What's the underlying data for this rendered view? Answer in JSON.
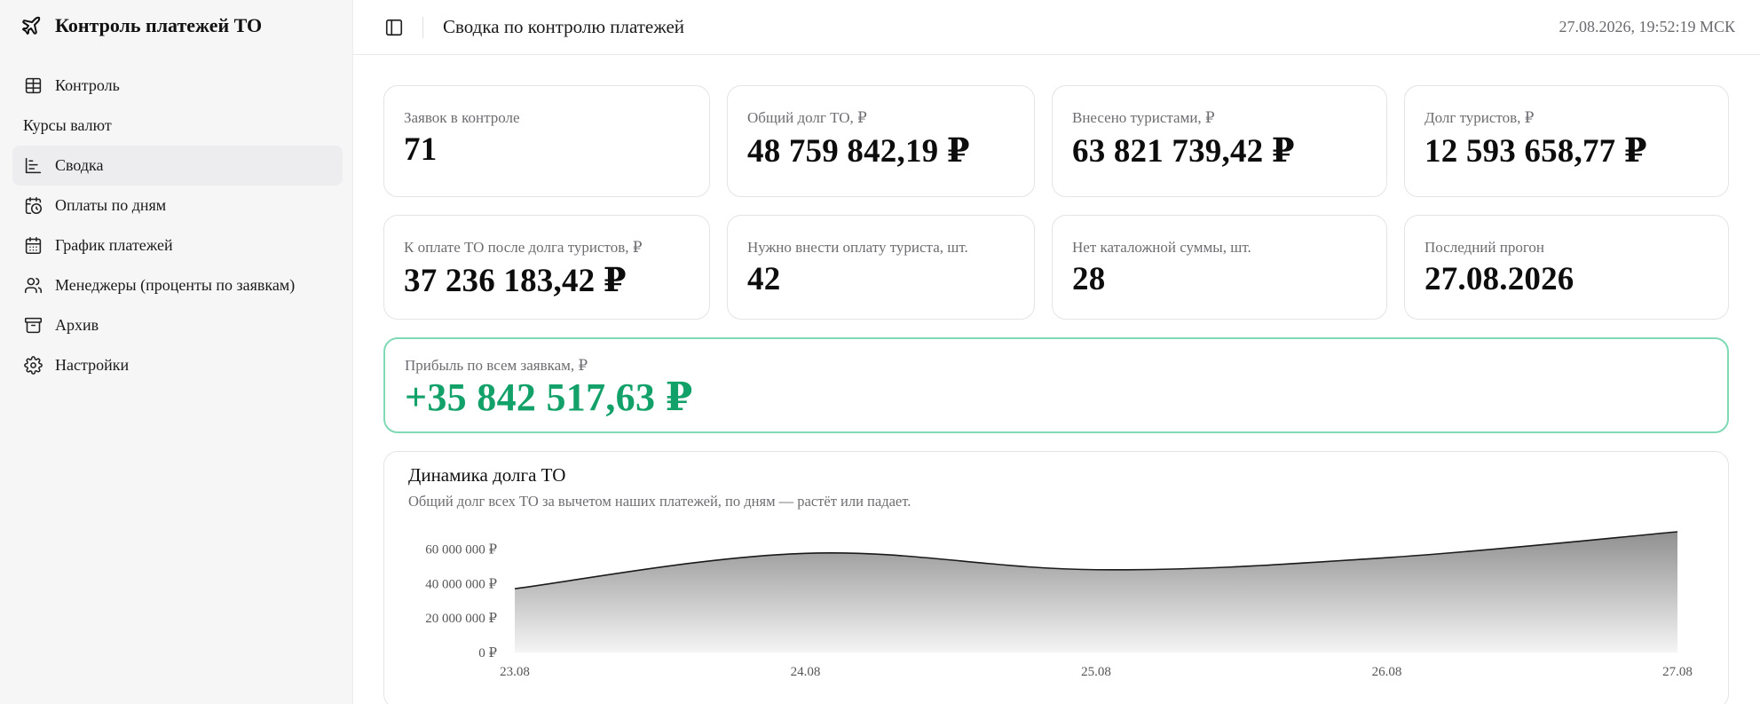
{
  "app": {
    "brand_title": "Контроль платежей ТО",
    "brand_icon": "plane-icon"
  },
  "sidebar": {
    "items": [
      {
        "label": "Контроль",
        "icon": "table-icon"
      },
      {
        "label": "Курсы валют",
        "icon": ""
      },
      {
        "label": "Сводка",
        "icon": "bar-chart-icon",
        "active": true
      },
      {
        "label": "Оплаты по дням",
        "icon": "calendar-clock-icon"
      },
      {
        "label": "График платежей",
        "icon": "calendar-icon"
      },
      {
        "label": "Менеджеры (проценты по заявкам)",
        "icon": "users-icon"
      },
      {
        "label": "Архив",
        "icon": "archive-icon"
      },
      {
        "label": "Настройки",
        "icon": "gear-icon"
      }
    ]
  },
  "header": {
    "title": "Сводка по контролю платежей",
    "timestamp": "27.08.2026, 19:52:19 МСК",
    "toggle_icon": "sidebar-toggle-icon"
  },
  "stats": [
    {
      "label": "Заявок в контроле",
      "value": "71"
    },
    {
      "label": "Общий долг ТО, ₽",
      "value": "48 759 842,19 ₽"
    },
    {
      "label": "Внесено туристами, ₽",
      "value": "63 821 739,42 ₽"
    },
    {
      "label": "Долг туристов, ₽",
      "value": "12 593 658,77 ₽"
    },
    {
      "label": "К оплате ТО после долга туристов, ₽",
      "value": "37 236 183,42 ₽"
    },
    {
      "label": "Нужно внести оплату туриста, шт.",
      "value": "42"
    },
    {
      "label": "Нет каталожной суммы, шт.",
      "value": "28"
    },
    {
      "label": "Последний прогон",
      "value": "27.08.2026"
    }
  ],
  "profit": {
    "label": "Прибыль по всем заявкам, ₽",
    "value": "+35 842 517,63 ₽",
    "color": "#13a16a",
    "border_color": "#7fd9b5"
  },
  "chart_data": {
    "type": "area",
    "title": "Динамика долга ТО",
    "subtitle": "Общий долг всех ТО за вычетом наших платежей, по дням — растёт или падает.",
    "x_ticks": [
      "23.08",
      "24.08",
      "25.08",
      "26.08",
      "27.08"
    ],
    "y_ticks": [
      {
        "value": 0,
        "label": "0 ₽"
      },
      {
        "value": 20000000,
        "label": "20 000 000 ₽"
      },
      {
        "value": 40000000,
        "label": "40 000 000 ₽"
      },
      {
        "value": 60000000,
        "label": "60 000 000 ₽"
      }
    ],
    "ylim": [
      0,
      70000000
    ],
    "grid": false,
    "series": [
      {
        "x": [
          "23.08",
          "24.08",
          "25.08",
          "26.08",
          "27.08"
        ],
        "values": [
          37000000,
          57500000,
          48000000,
          55000000,
          70000000
        ]
      }
    ]
  }
}
